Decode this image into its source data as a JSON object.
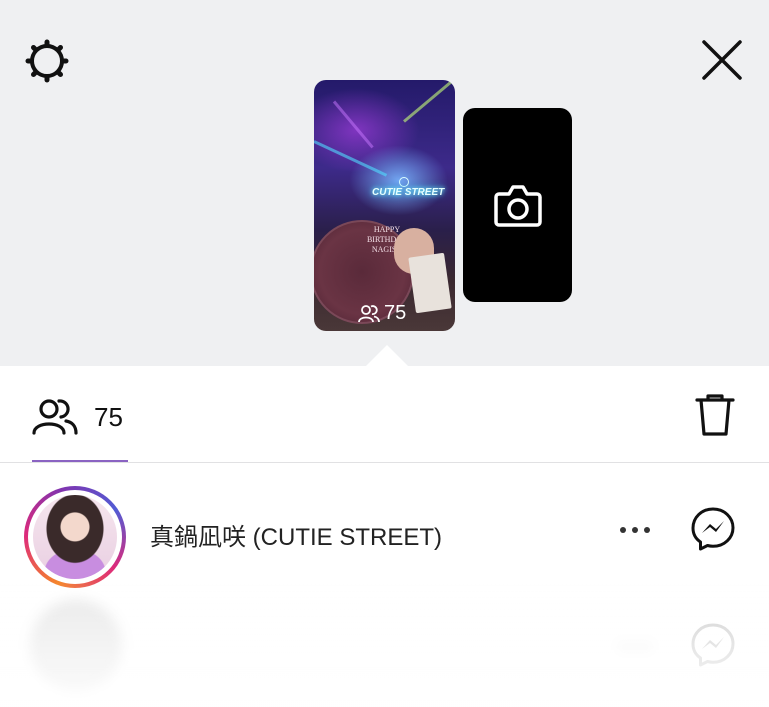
{
  "header": {
    "settings_icon": "gear-icon",
    "close_icon": "close-icon"
  },
  "story": {
    "viewer_count": "75",
    "signage_text": "CUTIE STREET",
    "fan_text": "HAPPY BIRTHDAY NAGISA",
    "camera_icon": "camera-icon"
  },
  "viewers_panel": {
    "people_icon": "people-icon",
    "count": "75",
    "delete_icon": "trash-icon",
    "accent_color": "#8a63c2"
  },
  "viewer_list": [
    {
      "name": "真鍋凪咲 (CUTIE STREET)",
      "more_icon": "more-horizontal-icon",
      "message_icon": "messenger-icon",
      "has_story_ring": true
    }
  ]
}
